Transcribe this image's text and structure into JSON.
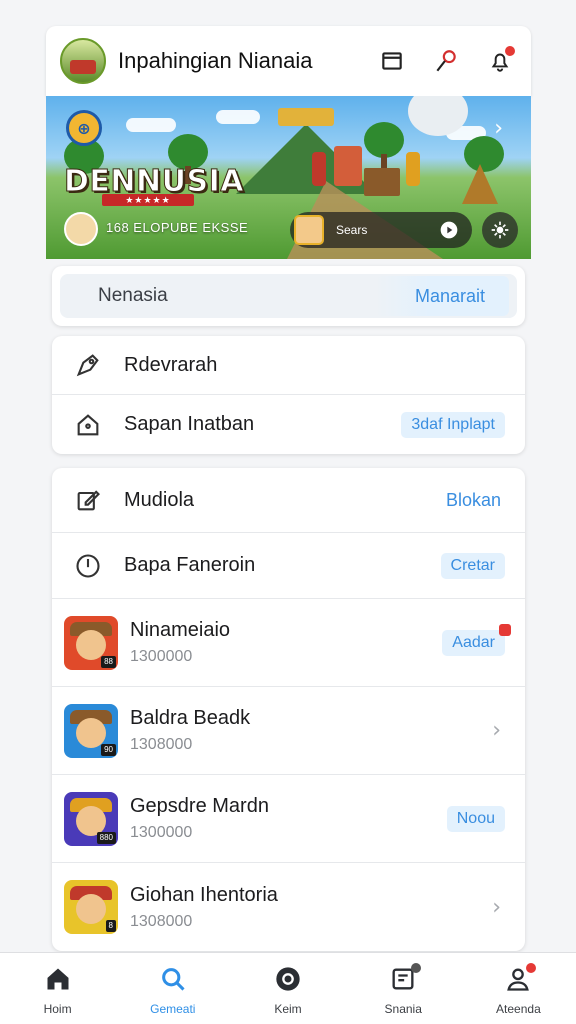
{
  "colors": {
    "accent": "#3a8ee0",
    "active_tab": "#2f8fe6",
    "notification": "#e53935"
  },
  "header": {
    "title": "Inpahingian Nianaia",
    "icons": [
      "avatar",
      "window-icon",
      "pin-icon",
      "bell-icon"
    ]
  },
  "banner": {
    "coin_glyph": "⊕",
    "title": "DENNUSIA",
    "ribbon": "★★★★★",
    "subtitle": "168 ELOPUBE EKSSE",
    "player_text": "Sears",
    "player_glyph": "◀▶",
    "chevron": "›"
  },
  "search": {
    "text": "Nenasia",
    "action": "Manarait"
  },
  "menu1": [
    {
      "label": "Rdevrarah",
      "icon": "tag-icon"
    },
    {
      "label": "Sapan Inatban",
      "icon": "home-icon",
      "pill": "3daf Inplapt"
    }
  ],
  "menu2": [
    {
      "label": "Mudiola",
      "icon": "edit-icon",
      "link": "Blokan"
    },
    {
      "label": "Bapa Fanerоin",
      "icon": "clock-icon",
      "pill": "Cretar"
    }
  ],
  "apps": [
    {
      "name": "Ninameiaio",
      "count": "1300000",
      "action": "Aadar",
      "bg": "#e04a2a",
      "badge": "88"
    },
    {
      "name": "Baldra Beadk",
      "count": "1308000",
      "action": "›",
      "bg": "#2a8ad8",
      "badge": "90"
    },
    {
      "name": "Gepsdre Mardn",
      "count": "1300000",
      "action": "Noou",
      "bg": "#4a3ab8",
      "badge": "880"
    },
    {
      "name": "Giohan Ihentoria",
      "count": "1308000",
      "action": "›",
      "bg": "#e8c42a",
      "badge": "8"
    }
  ],
  "tabs": [
    {
      "label": "Hoim",
      "icon": "home-icon"
    },
    {
      "label": "Gemeati",
      "icon": "search-icon",
      "active": true
    },
    {
      "label": "Keim",
      "icon": "record-icon"
    },
    {
      "label": "Snania",
      "icon": "inbox-icon"
    },
    {
      "label": "Ateenda",
      "icon": "profile-icon"
    }
  ]
}
